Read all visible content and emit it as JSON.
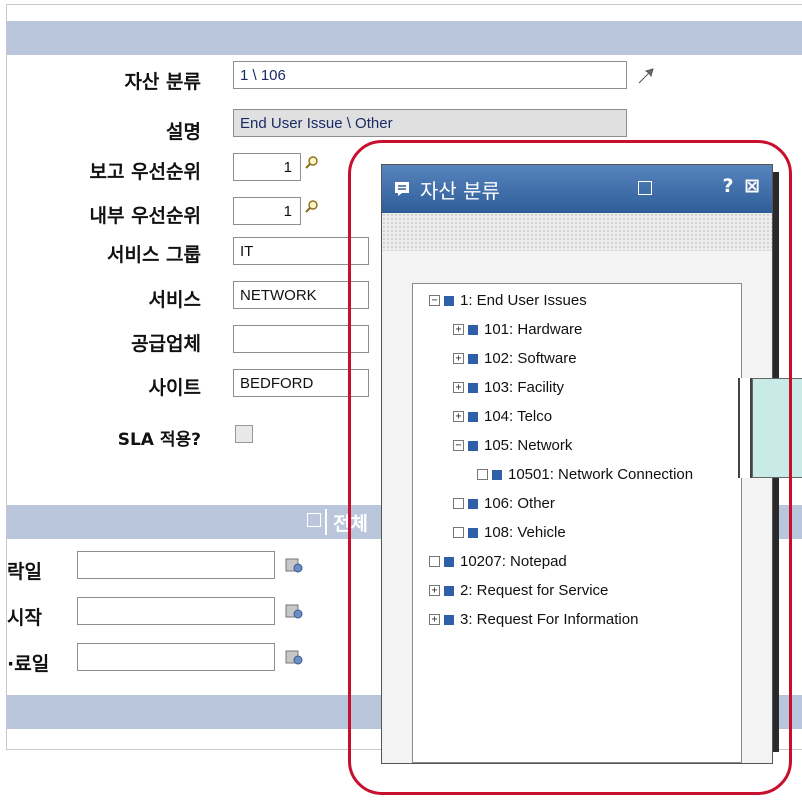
{
  "form": {
    "fields": [
      {
        "label": "자산 분류",
        "value": "1 \\ 106"
      },
      {
        "label": "설명",
        "value": "End User Issue \\ Other"
      },
      {
        "label": "보고 우선순위",
        "value": "1"
      },
      {
        "label": "내부 우선순위",
        "value": "1"
      },
      {
        "label": "서비스 그룹",
        "value": "IT"
      },
      {
        "label": "서비스",
        "value": "NETWORK"
      },
      {
        "label": "공급업체",
        "value": ""
      },
      {
        "label": "사이트",
        "value": "BEDFORD"
      },
      {
        "label": "SLA 적용?",
        "value": ""
      }
    ],
    "section2_title_partial": "전체",
    "dates": [
      {
        "label": "락일",
        "value": ""
      },
      {
        "label": "시작",
        "value": ""
      },
      {
        "label": "·료일",
        "value": ""
      }
    ]
  },
  "popup": {
    "title": "자산 분류",
    "tools": "? ⊠",
    "tree": [
      {
        "text": "1: End User Issues",
        "expander": "−",
        "indent": 0
      },
      {
        "text": "101: Hardware",
        "expander": "+",
        "indent": 1
      },
      {
        "text": "102: Software",
        "expander": "+",
        "indent": 1
      },
      {
        "text": "103: Facility",
        "expander": "+",
        "indent": 1
      },
      {
        "text": "104: Telco",
        "expander": "+",
        "indent": 1
      },
      {
        "text": "105: Network",
        "expander": "−",
        "indent": 1
      },
      {
        "text": "10501: Network Connection",
        "expander": "·",
        "indent": 2
      },
      {
        "text": "106: Other",
        "expander": "·",
        "indent": 1
      },
      {
        "text": "108: Vehicle",
        "expander": "·",
        "indent": 1
      },
      {
        "text": "10207: Notepad",
        "expander": "·",
        "indent": 0
      },
      {
        "text": "2: Request for Service",
        "expander": "+",
        "indent": 0
      },
      {
        "text": "3: Request For Information",
        "expander": "+",
        "indent": 0
      }
    ]
  },
  "colors": {
    "accent_ring": "#c8102e",
    "header_bar": "#b9c6dc",
    "popup_header": "#3f6da8",
    "tree_square": "#2f5fa8"
  }
}
